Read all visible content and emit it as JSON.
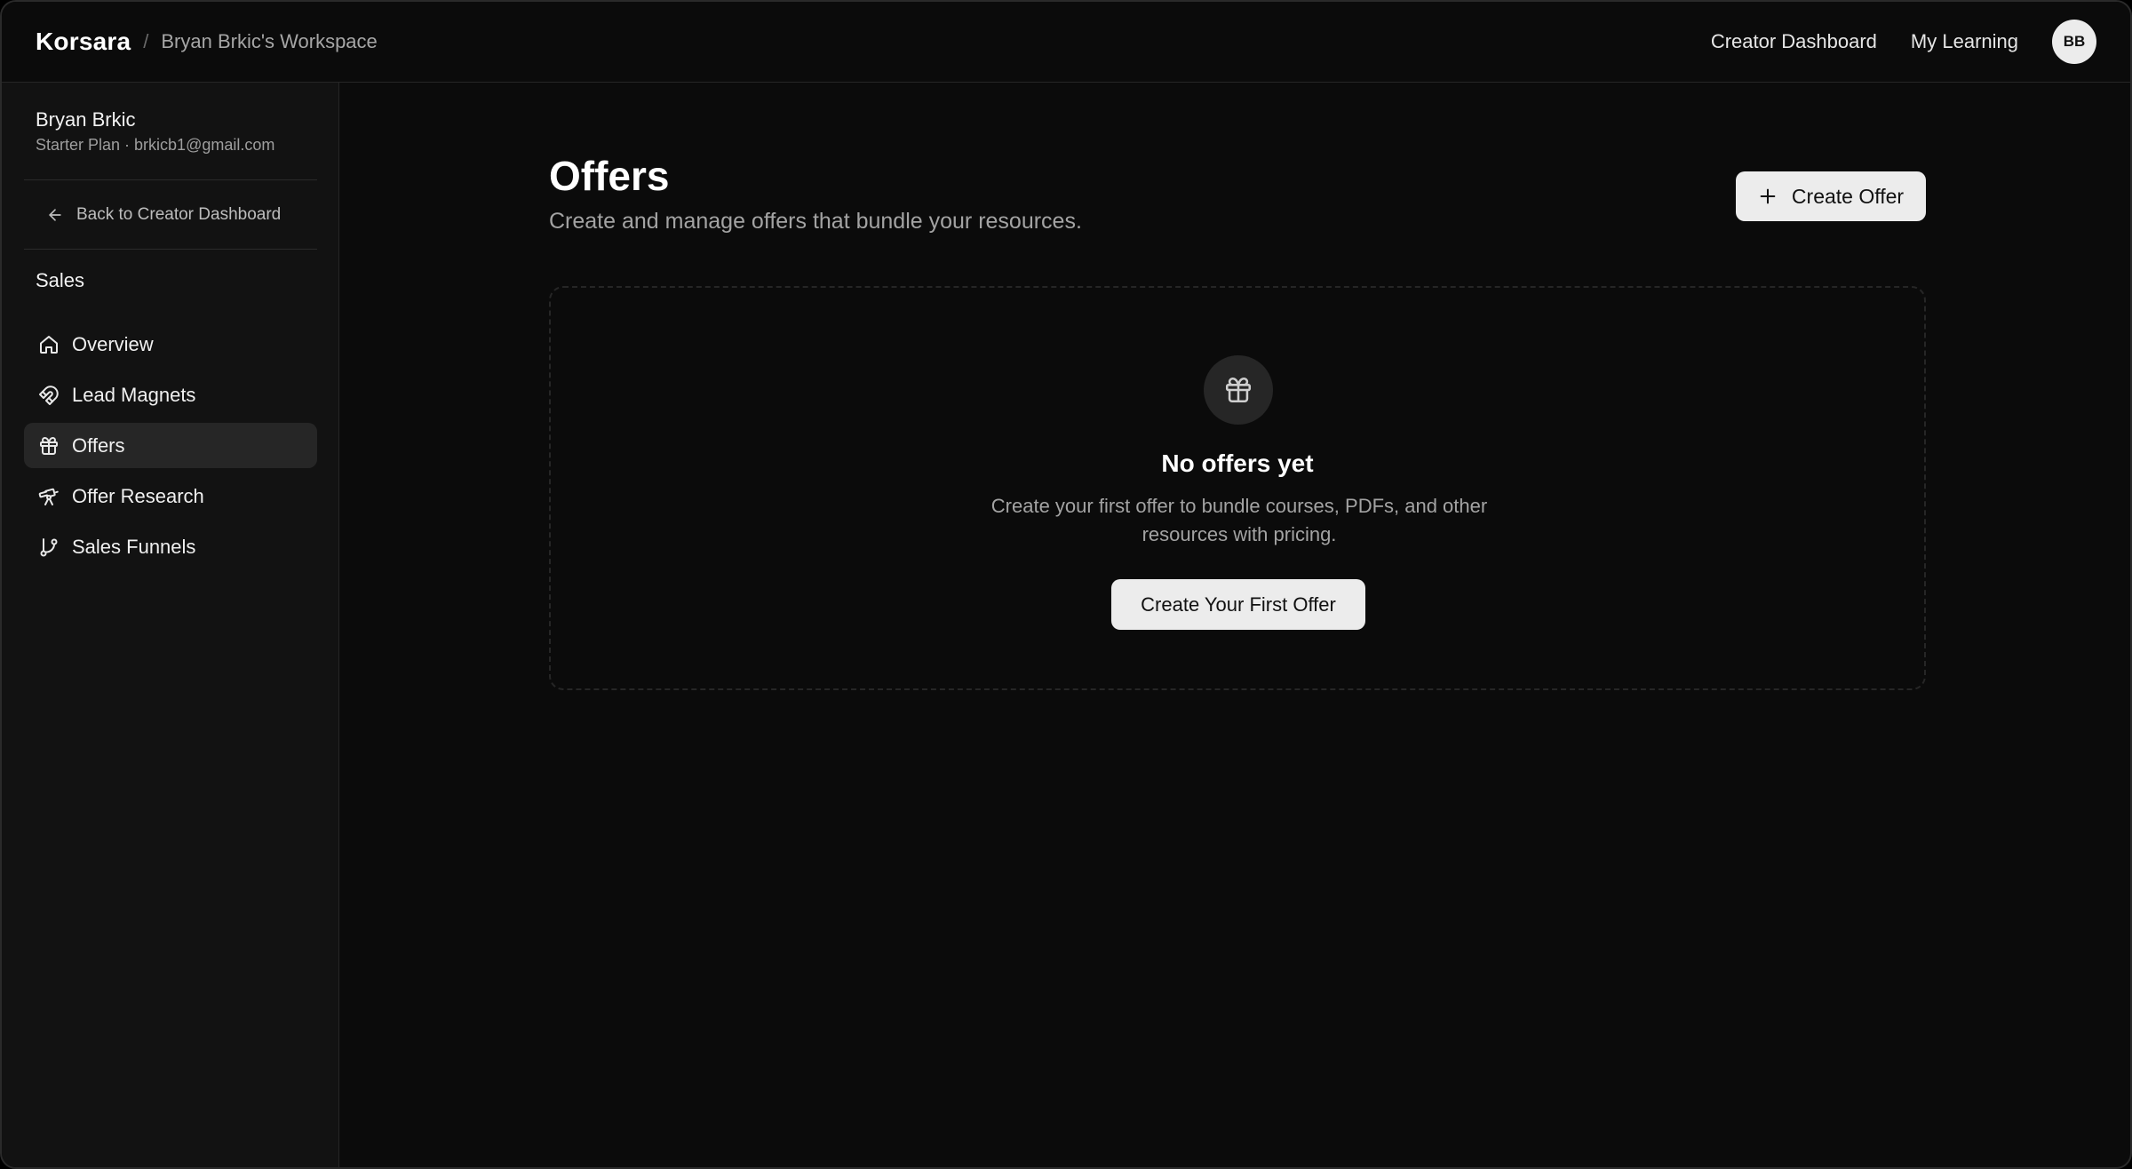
{
  "header": {
    "brand": "Korsara",
    "separator": "/",
    "workspace": "Bryan Brkic's Workspace",
    "links": [
      "Creator Dashboard",
      "My Learning"
    ],
    "avatar_initials": "BB"
  },
  "sidebar": {
    "user_name": "Bryan Brkic",
    "user_meta": "Starter Plan · brkicb1@gmail.com",
    "back_label": "Back to Creator Dashboard",
    "section_title": "Sales",
    "items": [
      {
        "label": "Overview",
        "icon": "home-icon",
        "active": false
      },
      {
        "label": "Lead Magnets",
        "icon": "magnet-icon",
        "active": false
      },
      {
        "label": "Offers",
        "icon": "gift-icon",
        "active": true
      },
      {
        "label": "Offer Research",
        "icon": "telescope-icon",
        "active": false
      },
      {
        "label": "Sales Funnels",
        "icon": "git-branch-icon",
        "active": false
      }
    ]
  },
  "main": {
    "title": "Offers",
    "subtitle": "Create and manage offers that bundle your resources.",
    "create_button": "Create Offer",
    "empty_state": {
      "icon": "gift-icon",
      "title": "No offers yet",
      "description": "Create your first offer to bundle courses, PDFs, and other resources with pricing.",
      "button": "Create Your First Offer"
    }
  },
  "colors": {
    "background": "#0b0b0b",
    "sidebar": "#121212",
    "active_item": "#262626",
    "button": "#ececec",
    "muted_text": "#a3a3a3"
  }
}
